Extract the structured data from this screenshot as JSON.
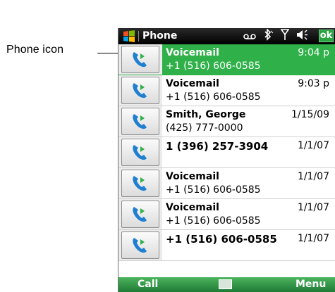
{
  "callout": {
    "label": "Phone icon"
  },
  "titlebar": {
    "title": "Phone",
    "ok_label": "ok",
    "icons": [
      "voicemail-icon",
      "bluetooth-icon",
      "signal-icon",
      "speaker-icon"
    ]
  },
  "calls": [
    {
      "name": "Voicemail",
      "number": "+1 (516) 606-0585",
      "date": "9:04 p",
      "selected": true
    },
    {
      "name": "Voicemail",
      "number": "+1 (516) 606-0585",
      "date": "9:03 p",
      "selected": false
    },
    {
      "name": "Smith, George",
      "number": "(425) 777-0000",
      "date": "1/15/09",
      "selected": false
    },
    {
      "name": "1 (396) 257-3904",
      "number": "",
      "date": "1/1/07",
      "selected": false
    },
    {
      "name": "Voicemail",
      "number": "+1 (516) 606-0585",
      "date": "1/1/07",
      "selected": false
    },
    {
      "name": "Voicemail",
      "number": "+1 (516) 606-0585",
      "date": "1/1/07",
      "selected": false
    },
    {
      "name": "+1 (516) 606-0585",
      "number": "",
      "date": "1/1/07",
      "selected": false
    }
  ],
  "menubar": {
    "left_softkey": "Call",
    "right_softkey": "Menu"
  },
  "colors": {
    "accent": "#2fb049",
    "titlebar": "#000000"
  }
}
